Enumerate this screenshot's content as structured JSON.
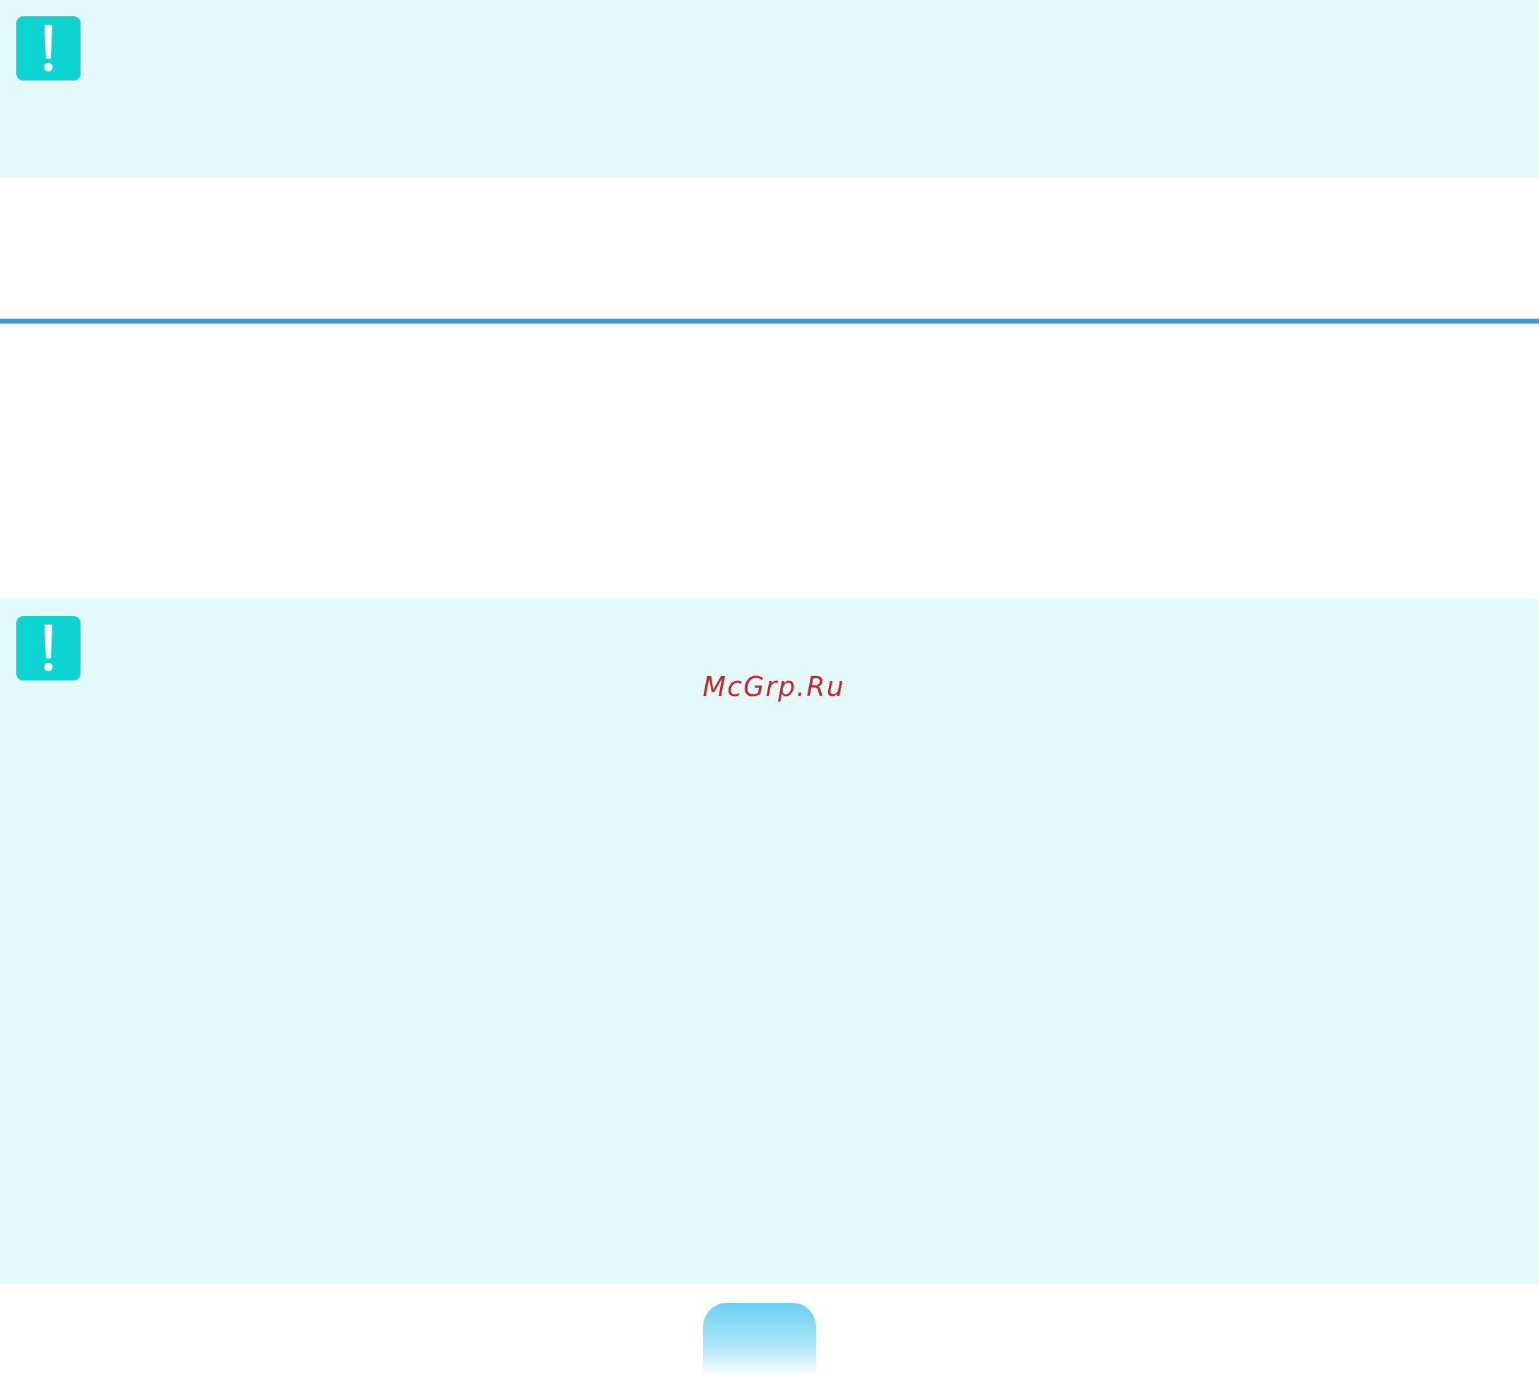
{
  "watermark": {
    "text": "McGrp.Ru",
    "color": "#c0282d"
  },
  "callouts": [
    {
      "icon": "exclamation-warning-icon",
      "color": "#0dd3d1",
      "background": "#e3f9fa"
    },
    {
      "icon": "exclamation-warning-icon",
      "color": "#0dd3d1",
      "background": "#e3f9fa"
    }
  ],
  "divider": {
    "color": "#3a9ed6"
  },
  "page_tab": {
    "number": ""
  }
}
